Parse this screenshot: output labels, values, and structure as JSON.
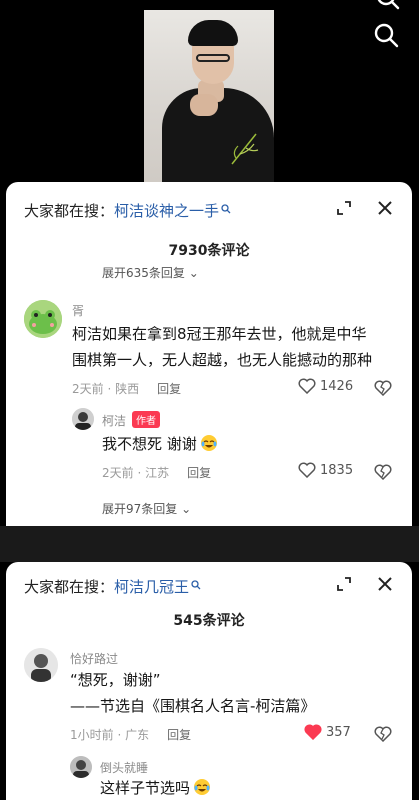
{
  "panel1": {
    "search_prefix": "大家都在搜：",
    "search_term": "柯洁谈神之一手",
    "comment_count": "7930条评论",
    "expand_top": "展开635条回复",
    "comment": {
      "username": "胥",
      "text_line1": "柯洁如果在拿到8冠王那年去世，他就是中华",
      "text_line2": "围棋第一人，无人超越，也无人能撼动的那种",
      "meta_time": "2天前 · 陕西",
      "reply_label": "回复",
      "likes": "1426"
    },
    "reply": {
      "username": "柯洁",
      "badge": "作者",
      "text": "我不想死 谢谢",
      "meta_time": "2天前 · 江苏",
      "reply_label": "回复",
      "likes": "1835"
    },
    "expand_more": "展开97条回复"
  },
  "panel2": {
    "search_prefix": "大家都在搜：",
    "search_term": "柯洁几冠王",
    "comment_count": "545条评论",
    "comment": {
      "username": "恰好路过",
      "text_line1": "“想死，谢谢”",
      "text_line2": "——节选自《围棋名人名言-柯洁篇》",
      "meta_time": "1小时前 · 广东",
      "reply_label": "回复",
      "likes": "357"
    },
    "reply": {
      "username": "倒头就睡",
      "text": "这样子节选吗"
    }
  },
  "colors": {
    "link_blue": "#2a5ea8",
    "author_badge": "#fb3a52",
    "liked_heart": "#fb3a52"
  },
  "icons": [
    "search-icon",
    "expand-icon",
    "close-icon",
    "heart-icon",
    "dislike-icon",
    "laugh-cry-emoji"
  ]
}
